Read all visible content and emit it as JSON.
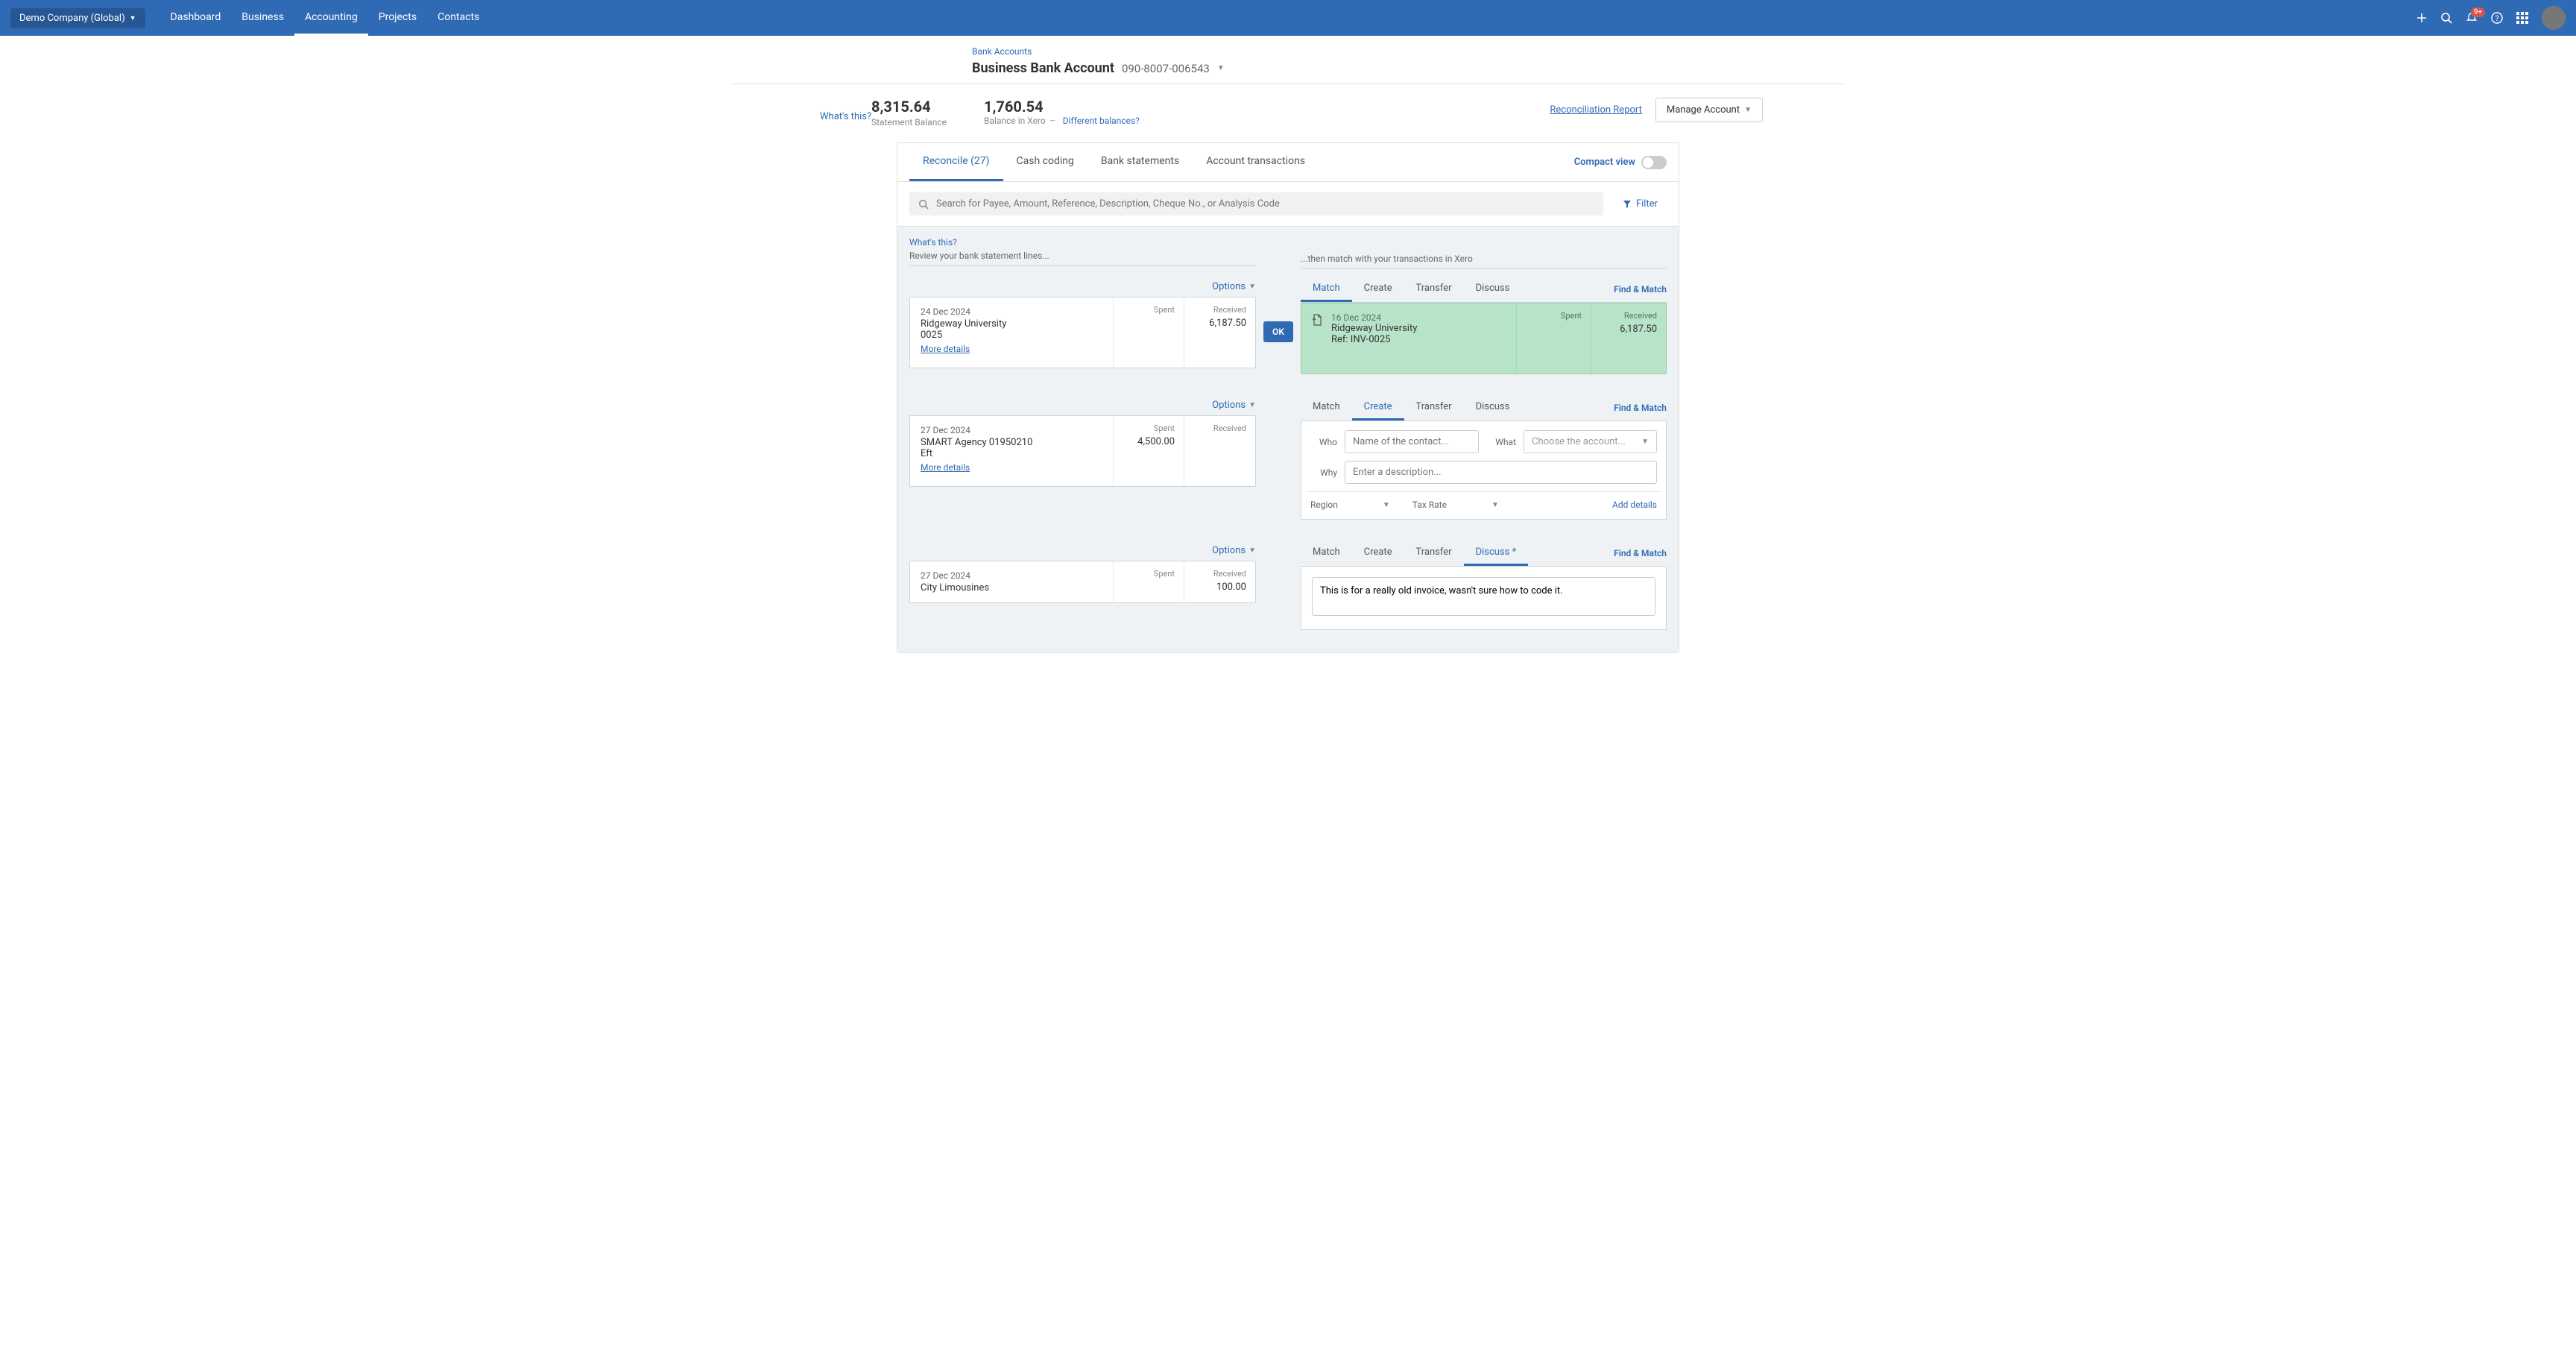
{
  "topnav": {
    "company": "Demo Company (Global)",
    "links": [
      "Dashboard",
      "Business",
      "Accounting",
      "Projects",
      "Contacts"
    ],
    "active_link_index": 2,
    "notification_badge": "9+"
  },
  "header": {
    "breadcrumb": "Bank Accounts",
    "account_name": "Business Bank Account",
    "account_number": "090-8007-006543"
  },
  "balances": {
    "statement_amount": "8,315.64",
    "statement_label": "Statement Balance",
    "xero_amount": "1,760.54",
    "xero_label": "Balance in Xero",
    "diff_link": "Different balances?",
    "whats_this": "What's this?",
    "recon_report": "Reconciliation Report",
    "manage_button": "Manage Account"
  },
  "tabs": {
    "items": [
      "Reconcile (27)",
      "Cash coding",
      "Bank statements",
      "Account transactions"
    ],
    "active_index": 0,
    "compact_label": "Compact view"
  },
  "search": {
    "placeholder": "Search for Payee, Amount, Reference, Description, Cheque No., or Analysis Code",
    "filter_label": "Filter"
  },
  "reconcile": {
    "whats_this": "What's this?",
    "left_instr": "Review your bank statement lines...",
    "right_instr": "...then match with your transactions in Xero",
    "options_label": "Options",
    "ok_label": "OK",
    "find_match_label": "Find & Match",
    "right_tabs": [
      "Match",
      "Create",
      "Transfer",
      "Discuss"
    ],
    "col_spent": "Spent",
    "col_received": "Received",
    "more_details": "More details"
  },
  "lines": [
    {
      "stmt": {
        "date": "24 Dec 2024",
        "payee": "Ridgeway University",
        "ref": "0025",
        "spent": "",
        "received": "6,187.50"
      },
      "right_active_tab": 0,
      "match": {
        "date": "16 Dec 2024",
        "payee": "Ridgeway University",
        "ref": "Ref: INV-0025",
        "spent": "",
        "received": "6,187.50"
      }
    },
    {
      "stmt": {
        "date": "27 Dec 2024",
        "payee": "SMART Agency 01950210",
        "ref": "Eft",
        "spent": "4,500.00",
        "received": ""
      },
      "right_active_tab": 1,
      "create": {
        "who_label": "Who",
        "who_placeholder": "Name of the contact...",
        "what_label": "What",
        "what_placeholder": "Choose the account...",
        "why_label": "Why",
        "why_placeholder": "Enter a description...",
        "region_label": "Region",
        "tax_label": "Tax Rate",
        "add_details": "Add details"
      }
    },
    {
      "stmt": {
        "date": "27 Dec 2024",
        "payee": "City Limousines",
        "ref": "",
        "spent": "",
        "received": "100.00"
      },
      "right_active_tab": 3,
      "discuss_tab_label": "Discuss *",
      "discuss": {
        "text": "This is for a really old invoice, wasn't sure how to code it."
      }
    }
  ]
}
